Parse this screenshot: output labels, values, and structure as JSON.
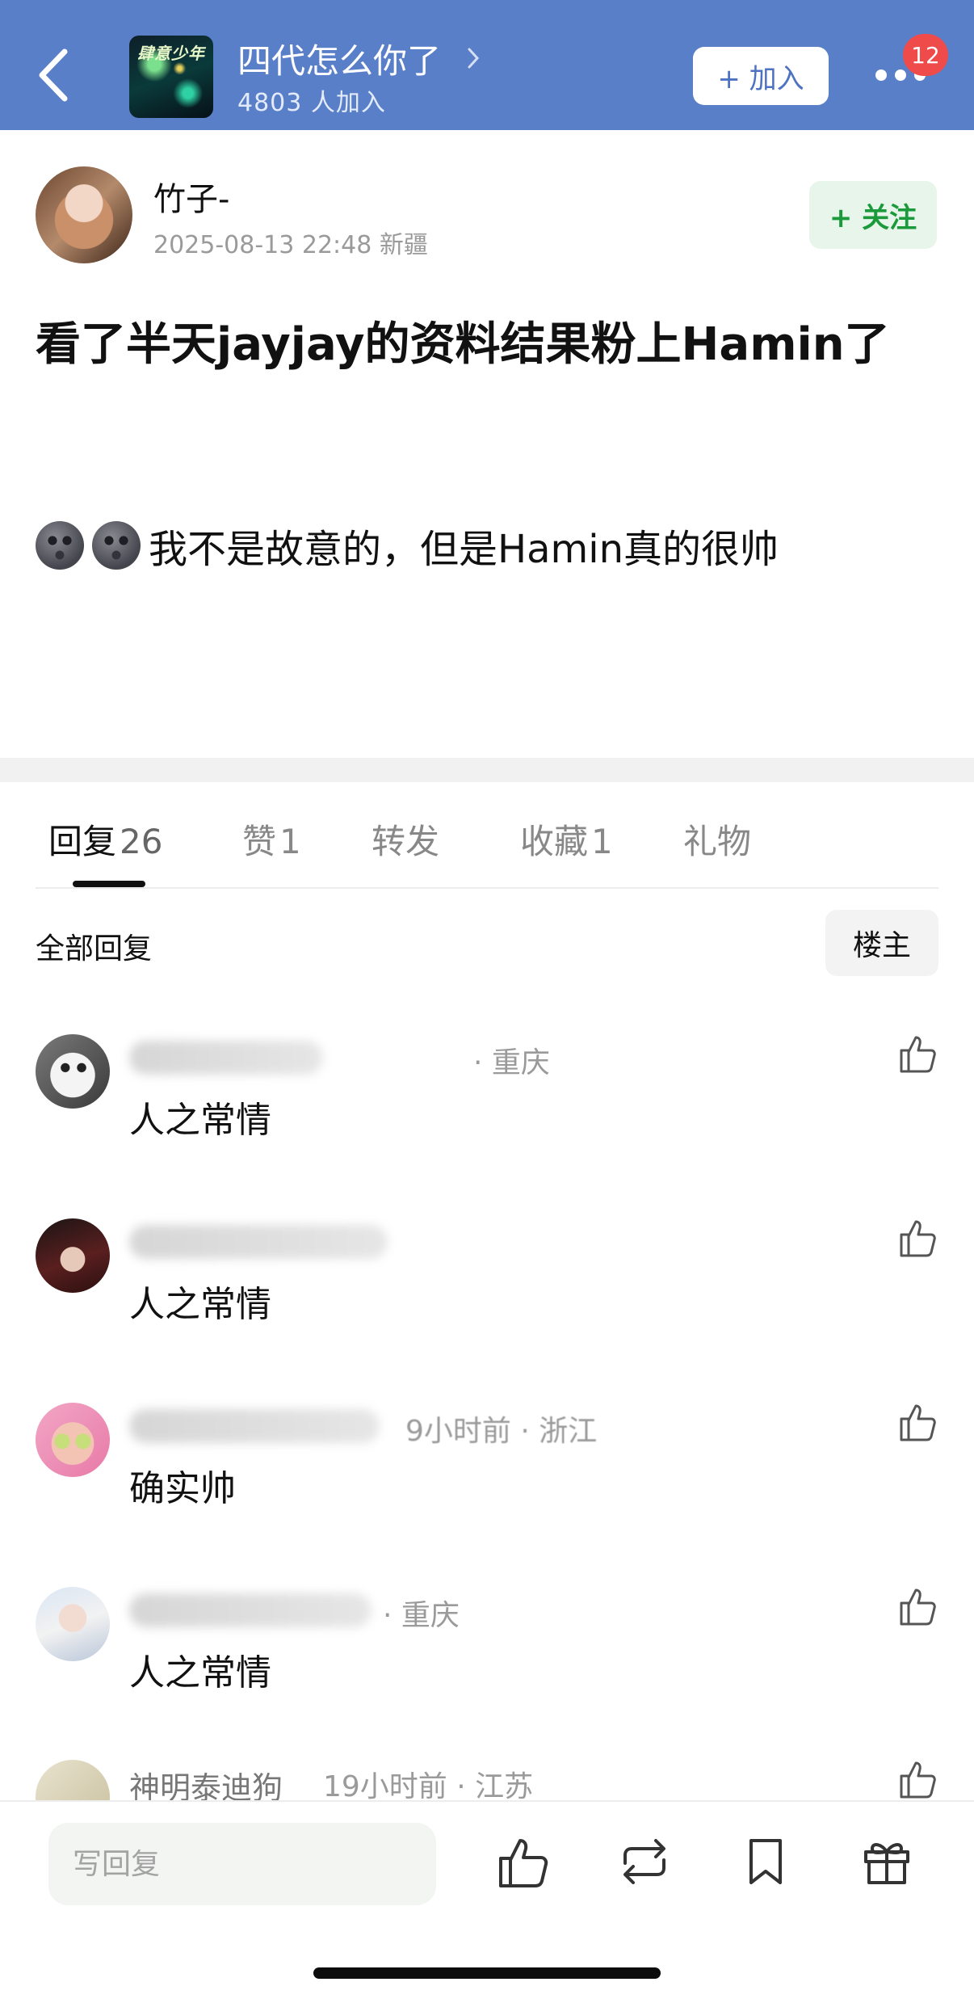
{
  "header": {
    "group_avatar_text": "肆意少年",
    "group_name": "四代怎么你了",
    "member_count": "4803 人加入",
    "join_label": "+ 加入",
    "notification_count": "12"
  },
  "post": {
    "author": "竹子-",
    "meta": "2025-08-13 22:48  新疆",
    "follow_label": "+ 关注",
    "title": "看了半天jayjay的资料结果粉上Hamin了",
    "body": "我不是故意的，但是Hamin真的很帅",
    "body_emoji": [
      "new-moon-face",
      "new-moon-face"
    ]
  },
  "tabs": [
    {
      "label": "回复",
      "count": "26"
    },
    {
      "label": "赞",
      "count": "1"
    },
    {
      "label": "转发",
      "count": ""
    },
    {
      "label": "收藏",
      "count": "1"
    },
    {
      "label": "礼物",
      "count": ""
    }
  ],
  "replies_header": {
    "title": "全部回复",
    "filter_label": "楼主"
  },
  "comments": [
    {
      "meta": "· 重庆",
      "text": "人之常情"
    },
    {
      "meta": "",
      "text": "人之常情"
    },
    {
      "meta": "9小时前 · 浙江",
      "text": "确实帅"
    },
    {
      "meta": "· 重庆",
      "text": "人之常情"
    },
    {
      "name": "神明泰迪狗",
      "meta": "19小时前 · 江苏",
      "text": ""
    }
  ],
  "bottom_bar": {
    "reply_placeholder": "写回复",
    "icons": [
      "like-icon",
      "repost-icon",
      "bookmark-icon",
      "gift-icon"
    ]
  },
  "colors": {
    "header_bg": "#5a7fc9",
    "follow_green": "#1b9a3c",
    "badge_red": "#ef4b4b"
  }
}
